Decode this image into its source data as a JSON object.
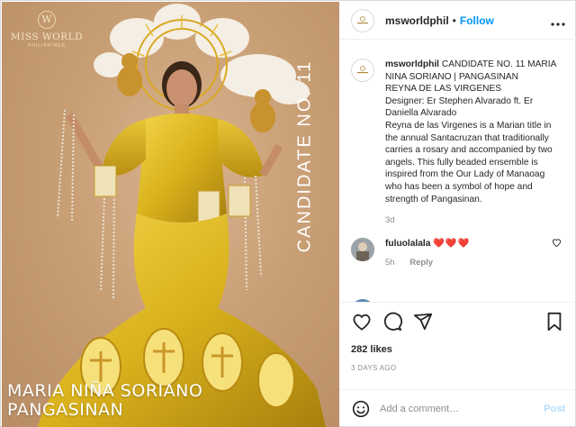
{
  "colors": {
    "accent": "#0095f6",
    "post_disabled": "#b2dffc",
    "heart_red": "#ed4956",
    "muted": "#8e8e8e",
    "photo_bg": "#c99f76",
    "gown_gold": "#d9b11c"
  },
  "photo": {
    "brand_name": "MISS WORLD",
    "brand_sub": "PHILIPPINES",
    "brand_crest": "W",
    "vertical_caption": "CANDIDATE NO. 11",
    "name_line1": "MARIA NIÑA SORIANO",
    "name_line2": "PANGASINAN"
  },
  "header": {
    "username": "msworldphil",
    "separator": "•",
    "follow_label": "Follow",
    "more_icon": "more-icon"
  },
  "caption": {
    "username": "msworldphil",
    "line1": "CANDIDATE NO. 11 MARIA NINA SORIANO | PANGASINAN",
    "line2": "REYNA DE LAS VIRGENES",
    "line3": "Designer: Er Stephen Alvarado ft. Er Daniella Alvarado",
    "line4": "Reyna de las Virgenes is a Marian title in the annual Santacruzan that traditionally carries a rosary and accompanied by two angels. This fully beaded ensemble is inspired from the Our Lady of Manaoag who has been a symbol of hope and strength of Pangasinan.",
    "time": "3d"
  },
  "comment": {
    "username": "fuluolalala",
    "text": "❤️❤️❤️",
    "time": "5h",
    "reply_label": "Reply"
  },
  "actions": {
    "icons": [
      "heart-icon",
      "comment-icon",
      "share-icon",
      "bookmark-icon"
    ],
    "likes": "282 likes",
    "posted": "3 DAYS AGO"
  },
  "add_comment": {
    "placeholder": "Add a comment…",
    "post_label": "Post",
    "emoji_icon": "smiley-icon"
  }
}
